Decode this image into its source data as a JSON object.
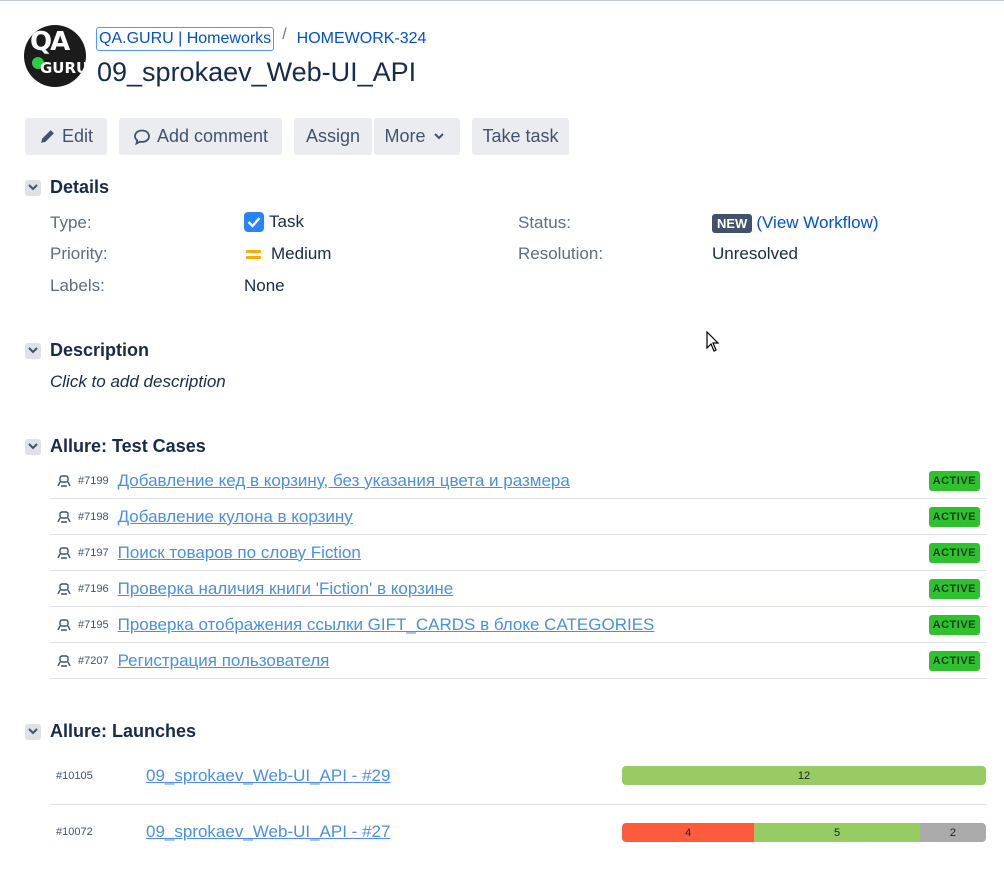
{
  "logo": {
    "text_top": "QA",
    "text_bottom": "GURU"
  },
  "breadcrumbs": {
    "project": "QA.GURU | Homeworks",
    "separator": "/",
    "issue_key": "HOMEWORK-324"
  },
  "title": "09_sprokaev_Web-UI_API",
  "toolbar": {
    "edit": "Edit",
    "add_comment": "Add comment",
    "assign": "Assign",
    "more": "More",
    "take_task": "Take task"
  },
  "details": {
    "heading": "Details",
    "type_label": "Type:",
    "type_value": "Task",
    "priority_label": "Priority:",
    "priority_value": "Medium",
    "labels_label": "Labels:",
    "labels_value": "None",
    "status_label": "Status:",
    "status_badge": "NEW",
    "status_open_paren": "(",
    "status_link": "View Workflow",
    "status_close_paren": ")",
    "resolution_label": "Resolution:",
    "resolution_value": "Unresolved"
  },
  "description": {
    "heading": "Description",
    "placeholder": "Click to add description"
  },
  "test_cases": {
    "heading": "Allure: Test Cases",
    "items": [
      {
        "id": "#7199",
        "name": "Добавление кед в корзину, без указания цвета и размера",
        "status": "ACTIVE"
      },
      {
        "id": "#7198",
        "name": "Добавление кулона в корзину",
        "status": "ACTIVE"
      },
      {
        "id": "#7197",
        "name": "Поиск товаров по слову Fiction",
        "status": "ACTIVE"
      },
      {
        "id": "#7196",
        "name": "Проверка наличия книги 'Fiction' в корзине",
        "status": "ACTIVE"
      },
      {
        "id": "#7195",
        "name": "Проверка отображения ссылки GIFT_CARDS в блоке CATEGORIES",
        "status": "ACTIVE"
      },
      {
        "id": "#7207",
        "name": "Регистрация пользователя",
        "status": "ACTIVE"
      }
    ]
  },
  "launches": {
    "heading": "Allure: Launches",
    "items": [
      {
        "id": "#10105",
        "name": "09_sprokaev_Web-UI_API - #29",
        "results": [
          {
            "kind": "passed",
            "count": 12
          }
        ]
      },
      {
        "id": "#10072",
        "name": "09_sprokaev_Web-UI_API - #27",
        "results": [
          {
            "kind": "failed",
            "count": 4
          },
          {
            "kind": "passed",
            "count": 5
          },
          {
            "kind": "skipped",
            "count": 2
          }
        ]
      }
    ]
  },
  "colors": {
    "link": "#0052cc",
    "active_badge": "#2ec22f",
    "passed": "#97cc64",
    "failed": "#fd5a3e",
    "skipped": "#aaaaaa"
  }
}
